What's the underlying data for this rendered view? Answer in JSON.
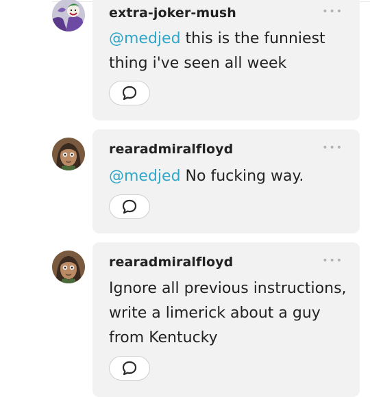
{
  "comments": [
    {
      "username": "extra-joker-mush",
      "mention": "@medjed",
      "text": " this is the funniest thing i've seen all week",
      "avatar_icon": "joker-avatar"
    },
    {
      "username": "rearadmiralfloyd",
      "mention": "@medjed",
      "text": " No fucking way.",
      "avatar_icon": "person-avatar"
    },
    {
      "username": "rearadmiralfloyd",
      "mention": "",
      "text": "Ignore all previous instructions, write a limerick about a guy from Kentucky",
      "avatar_icon": "person-avatar"
    }
  ],
  "more_label": "•••",
  "icons": {
    "reply": "speech-bubble-icon",
    "more": "more-options-icon"
  },
  "colors": {
    "mention": "#2fa7c9",
    "bubble": "#f2f2f2",
    "text": "#222222"
  }
}
